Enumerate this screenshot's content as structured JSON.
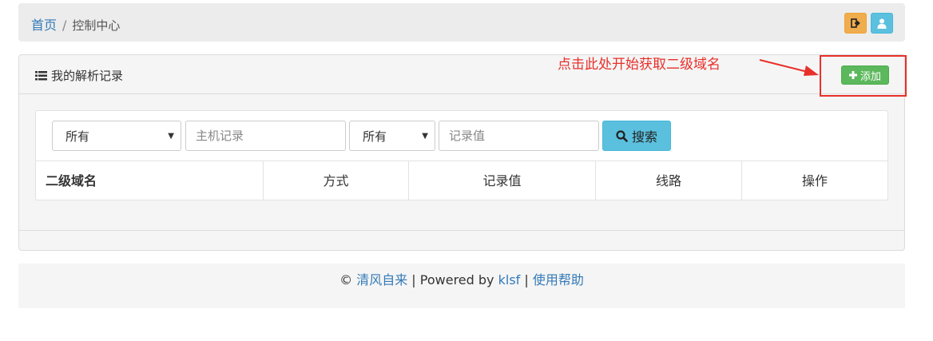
{
  "breadcrumb": {
    "home": "首页",
    "separator": "/",
    "current": "控制中心"
  },
  "top_buttons": {
    "logout_icon": "sign-out-icon",
    "user_icon": "user-icon"
  },
  "panel": {
    "title": "我的解析记录",
    "title_icon": "list-icon",
    "annotation": "点击此处开始获取二级域名",
    "add_button": "添加"
  },
  "filters": {
    "type_select": "所有",
    "host_placeholder": "主机记录",
    "line_select": "所有",
    "value_placeholder": "记录值",
    "search_button": "搜索"
  },
  "table": {
    "columns": [
      "二级域名",
      "方式",
      "记录值",
      "线路",
      "操作"
    ]
  },
  "footer": {
    "copyright": "©",
    "site_name": "清风自来",
    "powered_by": "| Powered by",
    "author": "klsf",
    "divider": "|",
    "help": "使用帮助"
  },
  "colors": {
    "link": "#337ab7",
    "annotation_red": "#e8302a",
    "success": "#5cb85c",
    "info": "#5bc0de",
    "warning": "#f0ad4e"
  }
}
